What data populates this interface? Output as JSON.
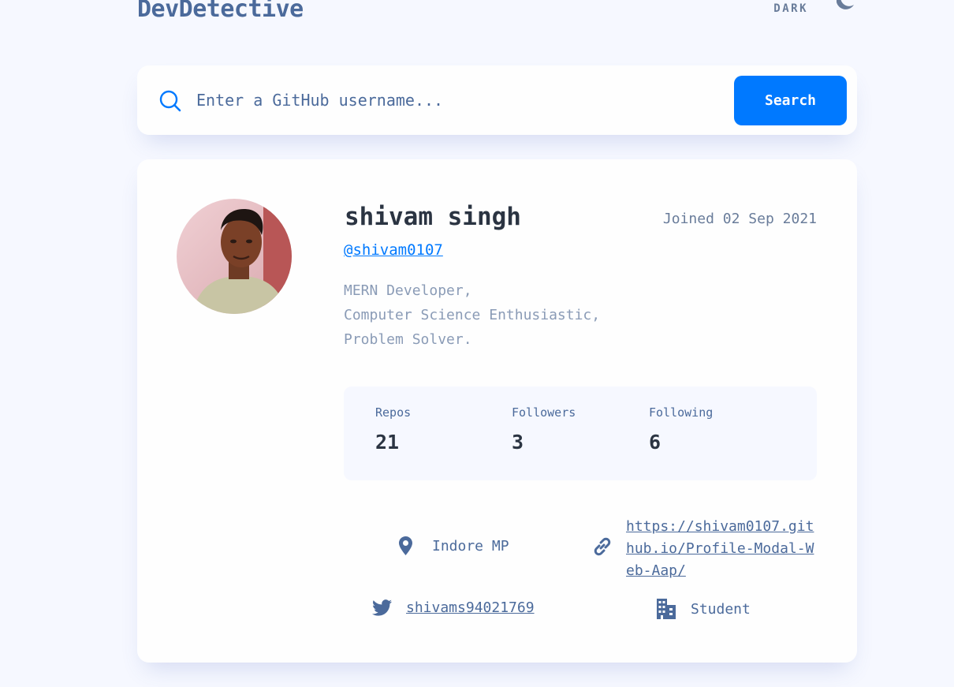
{
  "header": {
    "logo": "DevDetective",
    "theme_label": "DARK",
    "theme_icon": "moon-icon"
  },
  "search": {
    "placeholder": "Enter a GitHub username...",
    "value": "",
    "button_label": "Search",
    "icon": "search-icon"
  },
  "profile": {
    "name": "shivam singh",
    "joined": "Joined 02 Sep 2021",
    "username": "@shivam0107",
    "bio": "MERN Developer,\nComputer Science Enthusiastic,\nProblem Solver.",
    "stats": [
      {
        "label": "Repos",
        "value": "21"
      },
      {
        "label": "Followers",
        "value": "3"
      },
      {
        "label": "Following",
        "value": "6"
      }
    ],
    "location": {
      "icon": "location-pin-icon",
      "text": "Indore MP"
    },
    "blog": {
      "icon": "link-icon",
      "text": "https://shivam0107.github.io/Profile-Modal-Web-Aap/"
    },
    "twitter": {
      "icon": "twitter-icon",
      "text": "shivams94021769"
    },
    "company": {
      "icon": "building-icon",
      "text": "Student"
    }
  },
  "colors": {
    "background": "#f6f8ff",
    "card": "#fefefe",
    "accent": "#0079ff",
    "text_primary": "#2b3442",
    "text_secondary": "#4b6a9b"
  }
}
